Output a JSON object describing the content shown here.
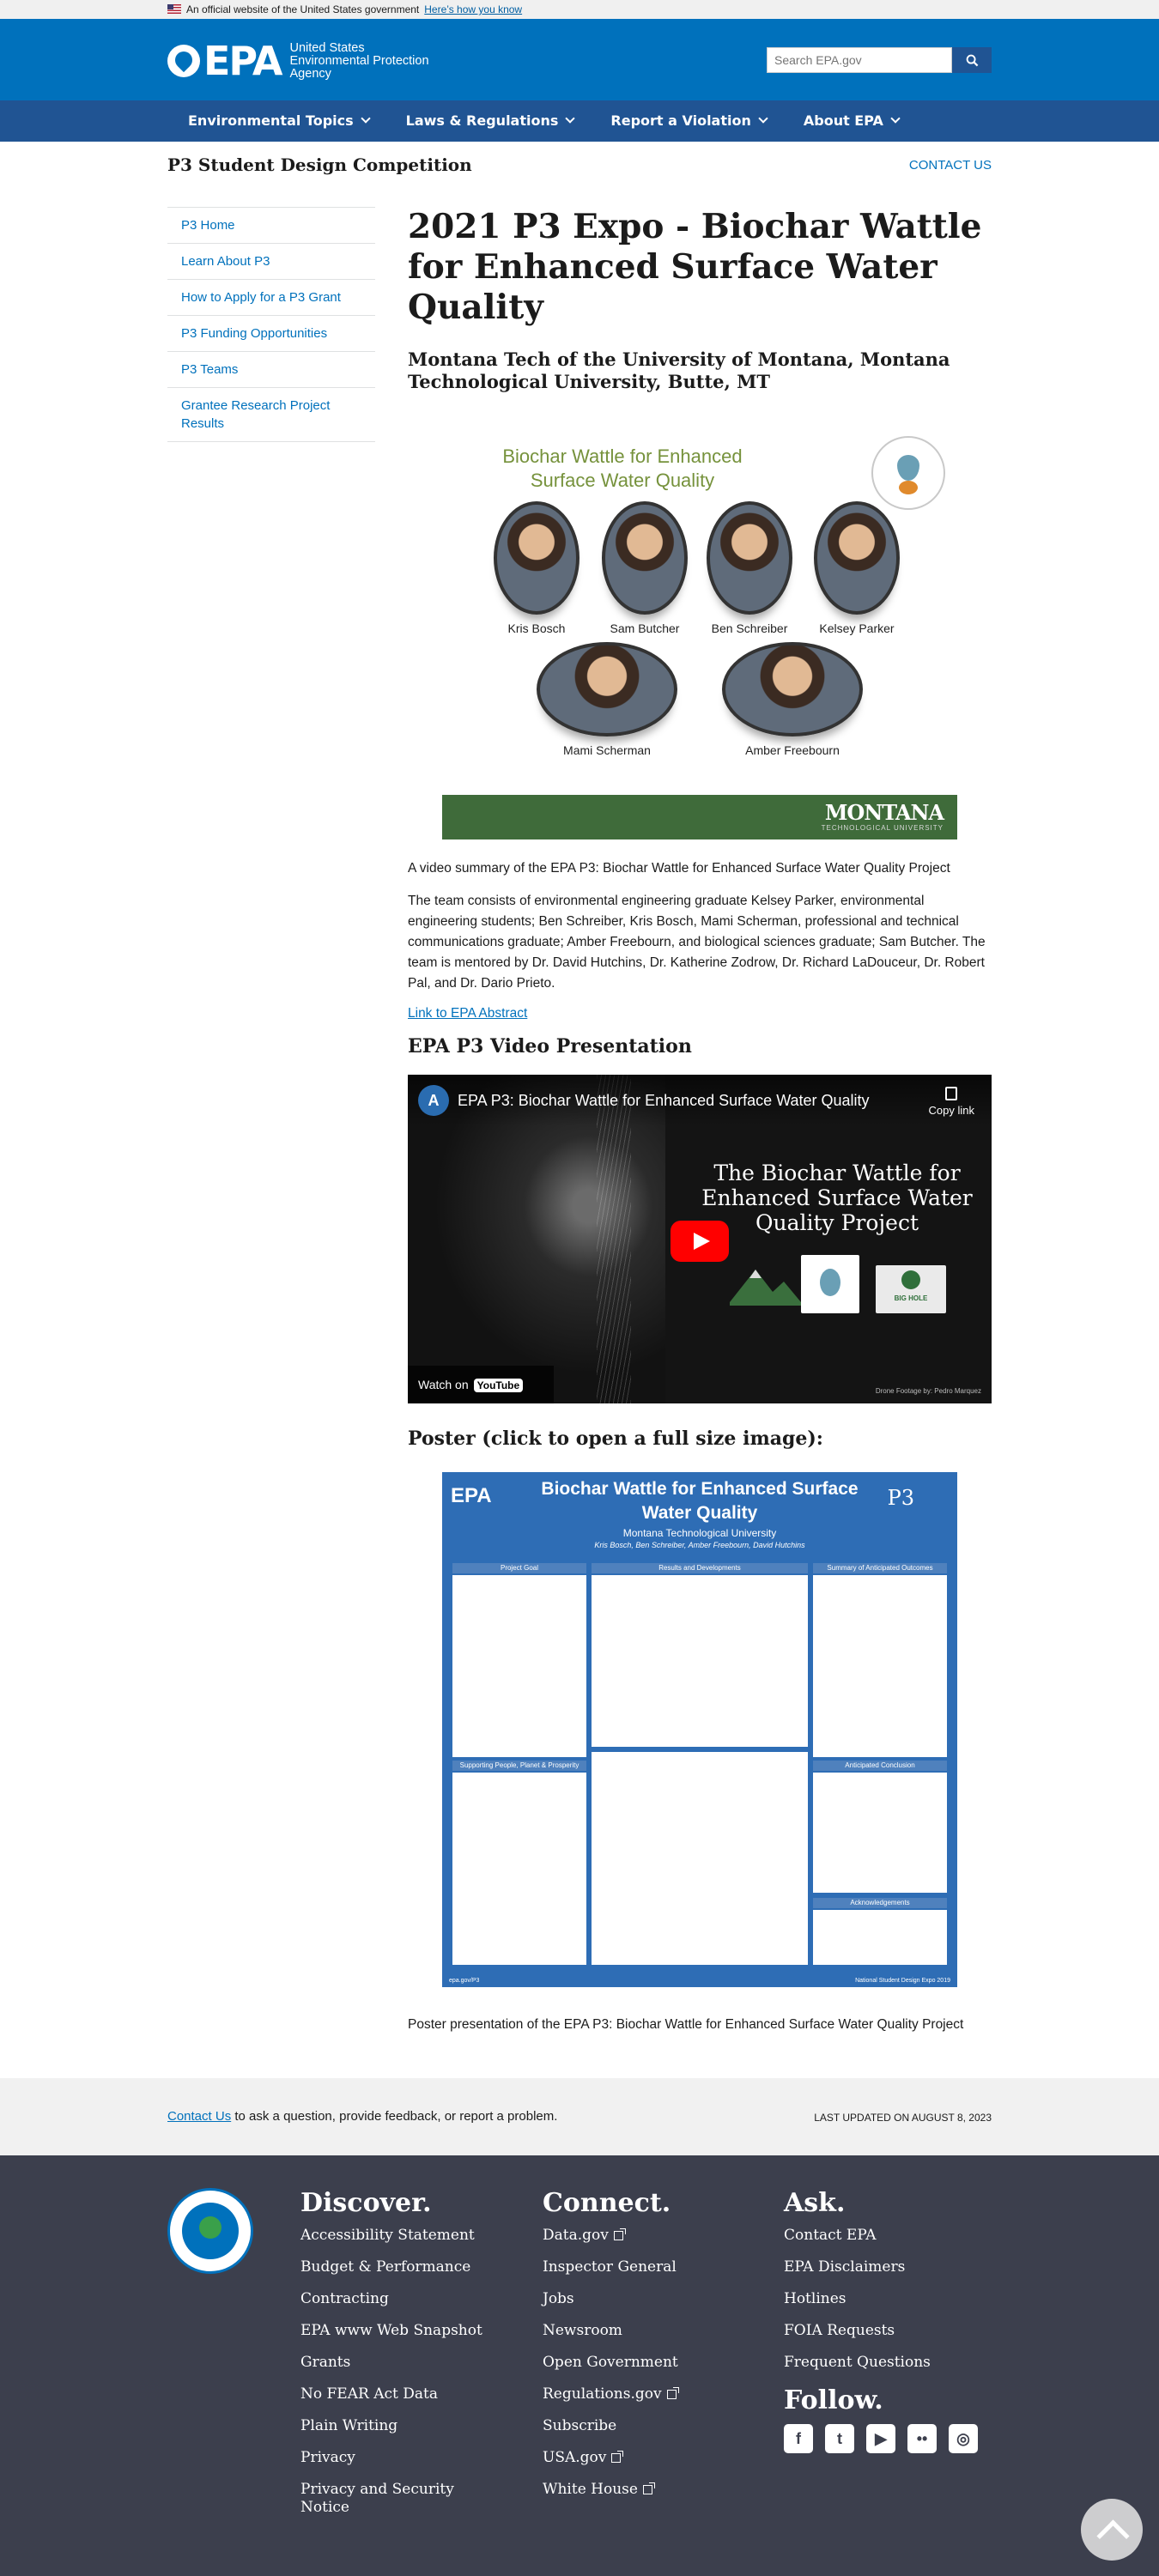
{
  "gov_banner": {
    "text": "An official website of the United States government",
    "link": "Here’s how you know"
  },
  "header": {
    "logo_text": "EPA",
    "agency_lines": [
      "United States",
      "Environmental Protection",
      "Agency"
    ],
    "search_placeholder": "Search EPA.gov"
  },
  "nav": {
    "items": [
      "Environmental Topics",
      "Laws & Regulations",
      "Report a Violation",
      "About EPA"
    ]
  },
  "section": {
    "title": "P3 Student Design Competition",
    "contact": "CONTACT US"
  },
  "sidebar": {
    "items": [
      "P3 Home",
      "Learn About P3",
      "How to Apply for a P3 Grant",
      "P3 Funding Opportunities",
      "P3 Teams",
      "Grantee Research Project Results"
    ]
  },
  "main": {
    "title": "2021 P3 Expo - Biochar Wattle for Enhanced Surface Water Quality",
    "subtitle": "Montana Tech of the University of Montana, Montana Technological University, Butte, MT",
    "team_image": {
      "title": "Biochar Wattle for Enhanced Surface Water Quality",
      "members": [
        "Kris Bosch",
        "Sam Butcher",
        "Ben Schreiber",
        "Kelsey Parker",
        "Mami Scherman",
        "Amber Freebourn"
      ],
      "band_title": "MONTANA",
      "band_sub": "TECHNOLOGICAL UNIVERSITY"
    },
    "video_summary": "A video summary of the EPA P3: Biochar Wattle for Enhanced Surface Water Quality Project",
    "team_paragraph": "The team consists of environmental engineering graduate Kelsey Parker, environmental engineering students; Ben Schreiber, Kris Bosch, Mami Scherman, professional and technical communications graduate; Amber Freebourn, and biological sciences graduate; Sam Butcher. The team is mentored by Dr. David Hutchins, Dr. Katherine Zodrow, Dr. Richard LaDouceur, Dr. Robert Pal, and Dr. Dario Prieto.",
    "abstract_link": "Link to EPA Abstract",
    "video_heading": "EPA P3 Video Presentation",
    "video": {
      "title": "EPA P3: Biochar Wattle for Enhanced Surface Water Quality",
      "copy_link": "Copy link",
      "overlay_title": "The Biochar Wattle for Enhanced Surface Water Quality Project",
      "watch_on": "Watch on",
      "youtube": "YouTube",
      "credit": "Drone Footage by: Pedro Marquez",
      "logo3_text": "BIG HOLE"
    },
    "poster_heading": "Poster (click to open a full size image):",
    "poster": {
      "epa": "EPA",
      "title": "Biochar Wattle for Enhanced Surface Water Quality",
      "p3": "P3",
      "institution": "Montana Technological University",
      "authors": "Kris Bosch, Ben Schreiber, Amber Freebourn, David Hutchins",
      "col_heads": [
        "Project Goal",
        "Results and Developments",
        "Summary of Anticipated Outcomes"
      ],
      "heads2": [
        "Supporting People, Planet & Prosperity",
        "Anticipated Conclusion",
        "Acknowledgements"
      ],
      "footer_left": "epa.gov/P3",
      "footer_right": "National Student Design Expo 2019"
    },
    "poster_caption": "Poster presentation of the EPA P3: Biochar Wattle for Enhanced Surface Water Quality Project"
  },
  "contact_strip": {
    "link": "Contact Us",
    "text": " to ask a question, provide feedback, or report a problem.",
    "updated": "LAST UPDATED ON AUGUST 8, 2023"
  },
  "footer": {
    "discover": {
      "title": "Discover.",
      "links": [
        "Accessibility Statement",
        "Budget & Performance",
        "Contracting",
        "EPA www Web Snapshot",
        "Grants",
        "No FEAR Act Data",
        "Plain Writing",
        "Privacy",
        "Privacy and Security Notice"
      ]
    },
    "connect": {
      "title": "Connect.",
      "links": [
        "Data.gov",
        "Inspector General",
        "Jobs",
        "Newsroom",
        "Open Government",
        "Regulations.gov",
        "Subscribe",
        "USA.gov",
        "White House"
      ]
    },
    "ask": {
      "title": "Ask.",
      "links": [
        "Contact EPA",
        "EPA Disclaimers",
        "Hotlines",
        "FOIA Requests",
        "Frequent Questions"
      ]
    },
    "follow": {
      "title": "Follow.",
      "icons": [
        "facebook-icon",
        "twitter-icon",
        "youtube-icon",
        "flickr-icon",
        "instagram-icon"
      ]
    }
  },
  "colors": {
    "header_blue": "#0071bc",
    "nav_blue": "#205493",
    "footer_dark": "#3c3f4d",
    "link_blue": "#0071bc"
  }
}
